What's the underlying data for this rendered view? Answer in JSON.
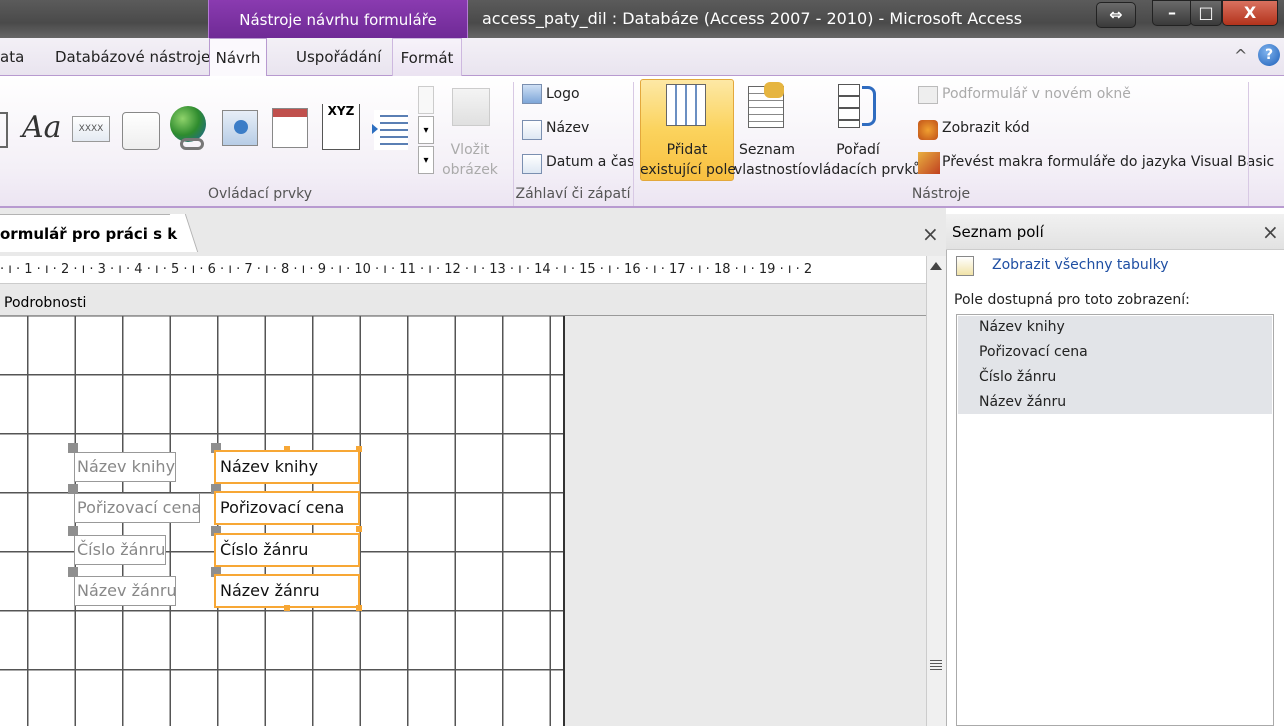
{
  "window": {
    "context_tab_header": "Nástroje návrhu formuláře",
    "title": "access_paty_dil : Databáze (Access 2007 - 2010)  -  Microsoft Access",
    "controls": {
      "restore": "⇔",
      "minimize": "–",
      "maximize": "□",
      "close": "X"
    }
  },
  "tabs": [
    {
      "label": "ata"
    },
    {
      "label": "Databázové nástroje"
    },
    {
      "label": "Návrh"
    },
    {
      "label": "Uspořádání"
    },
    {
      "label": "Formát"
    }
  ],
  "ribbon": {
    "controls_group": {
      "label": "Ovládací prvky",
      "gallery_items": [
        "label-icon",
        "aa-icon",
        "textbox-icon",
        "tab-control-icon",
        "hyperlink-icon",
        "image-icon",
        "subform-icon",
        "chart-icon",
        "list-icon"
      ],
      "aa_text": "Aa",
      "textbox_text": "XXXX",
      "xyz_text": "XYZ",
      "insert_image": [
        "Vložit",
        "obrázek"
      ]
    },
    "header_footer_group": {
      "label": "Záhlaví či zápatí",
      "logo": "Logo",
      "title": "Název",
      "datetime": "Datum a čas"
    },
    "tools_group": {
      "label": "Nástroje",
      "add_fields": [
        "Přidat",
        "existující pole"
      ],
      "property_sheet": [
        "Seznam",
        "vlastností"
      ],
      "tab_order": [
        "Pořadí",
        "ovládacích prvků"
      ],
      "subform_window": "Podformulář v novém okně",
      "view_code": "Zobrazit kód",
      "convert_macros": "Převést makra formuláře do jazyka Visual Basic"
    },
    "help": "?",
    "collapse": "^"
  },
  "document": {
    "tab_title": "ormulář pro práci s knihami",
    "close": "×",
    "ruler": "· ı · 1 · ı · 2 · ı · 3 · ı · 4 · ı · 5 · ı · 6 · ı · 7 · ı · 8 · ı · 9 · ı · 10 · ı · 11 · ı · 12 · ı · 13 · ı · 14 · ı · 15 · ı · 16 · ı · 17 · ı · 18 · ı · 19 · ı · 2",
    "section": "Podrobnosti",
    "labels": [
      "Název knihy",
      "Pořizovací cena",
      "Číslo žánru",
      "Název žánru"
    ],
    "textboxes": [
      "Název knihy",
      "Pořizovací cena",
      "Číslo žánru",
      "Název žánru"
    ]
  },
  "field_list_panel": {
    "title": "Seznam polí",
    "close": "×",
    "show_all": "Zobrazit všechny tabulky",
    "available_label": "Pole dostupná pro toto zobrazení:",
    "fields": [
      "Název knihy",
      "Pořizovací cena",
      "Číslo žánru",
      "Název žánru"
    ]
  }
}
